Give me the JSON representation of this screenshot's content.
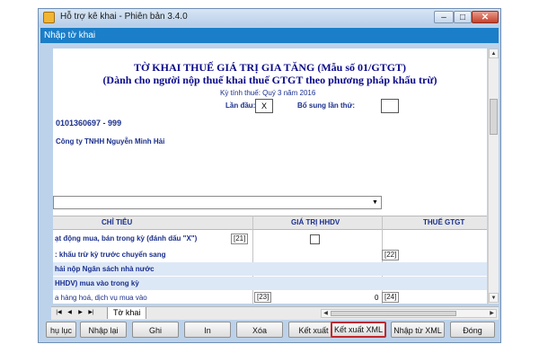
{
  "window": {
    "title": "Hỗ trợ kê khai - Phiên bản 3.4.0",
    "controls": {
      "minimize": "–",
      "maximize": "□",
      "close": "✕"
    }
  },
  "subtitle": "Nhập tờ khai",
  "form": {
    "title": "TỜ KHAI THUẾ GIÁ TRỊ GIA TĂNG (Mẫu số 01/GTGT)",
    "subtitle": "(Dành cho người nộp thuế khai thuế GTGT theo phương pháp khấu trừ)",
    "period": "Kỳ tính thuế: Quý 3 năm 2016",
    "first_time_label": "Lần đầu:",
    "first_time_value": "X",
    "supplement_label": "Bổ sung lần thứ:",
    "supplement_value": "",
    "tax_id": "0101360697  -  999",
    "company": "Công ty TNHH Nguyễn Minh Hải",
    "combo_value": "",
    "combo_arrow": "▼"
  },
  "table": {
    "headers": [
      "CHỈ TIÊU",
      "GIÁ TRỊ HHDV",
      "THUẾ GTGT"
    ],
    "rows": [
      {
        "label": "ạt động mua, bán trong kỳ (đánh dấu \"X\")",
        "code": "[21]"
      },
      {
        "label": ": khấu trừ kỳ trước chuyển sang",
        "code": "[22]"
      },
      {
        "label": "hải nộp Ngân sách nhà nước"
      },
      {
        "label": "HHDV) mua vào trong kỳ"
      },
      {
        "label": "a hàng hoá, dịch vụ mua vào",
        "code": "[23]",
        "value": "0",
        "code2": "[24]"
      }
    ]
  },
  "tabstrip": {
    "nav": [
      "|◀",
      "◀",
      "▶",
      "▶|"
    ],
    "tab_label": "Tờ khai"
  },
  "buttons": {
    "appendix": "hụ lục",
    "reimport": "Nhập lại",
    "save": "Ghi",
    "print": "In",
    "delete": "Xóa",
    "export": "Kết xuất",
    "export_xml": "Kết xuất XML",
    "import_xml": "Nhập từ XML",
    "close": "Đóng"
  },
  "scroll_arrows": {
    "up": "▲",
    "down": "▼",
    "left": "◀",
    "right": "▶"
  },
  "colors": {
    "title_blue": "#0b0a8a",
    "subtitle_bar": "#1b7ec8",
    "highlight": "#c0282d"
  }
}
